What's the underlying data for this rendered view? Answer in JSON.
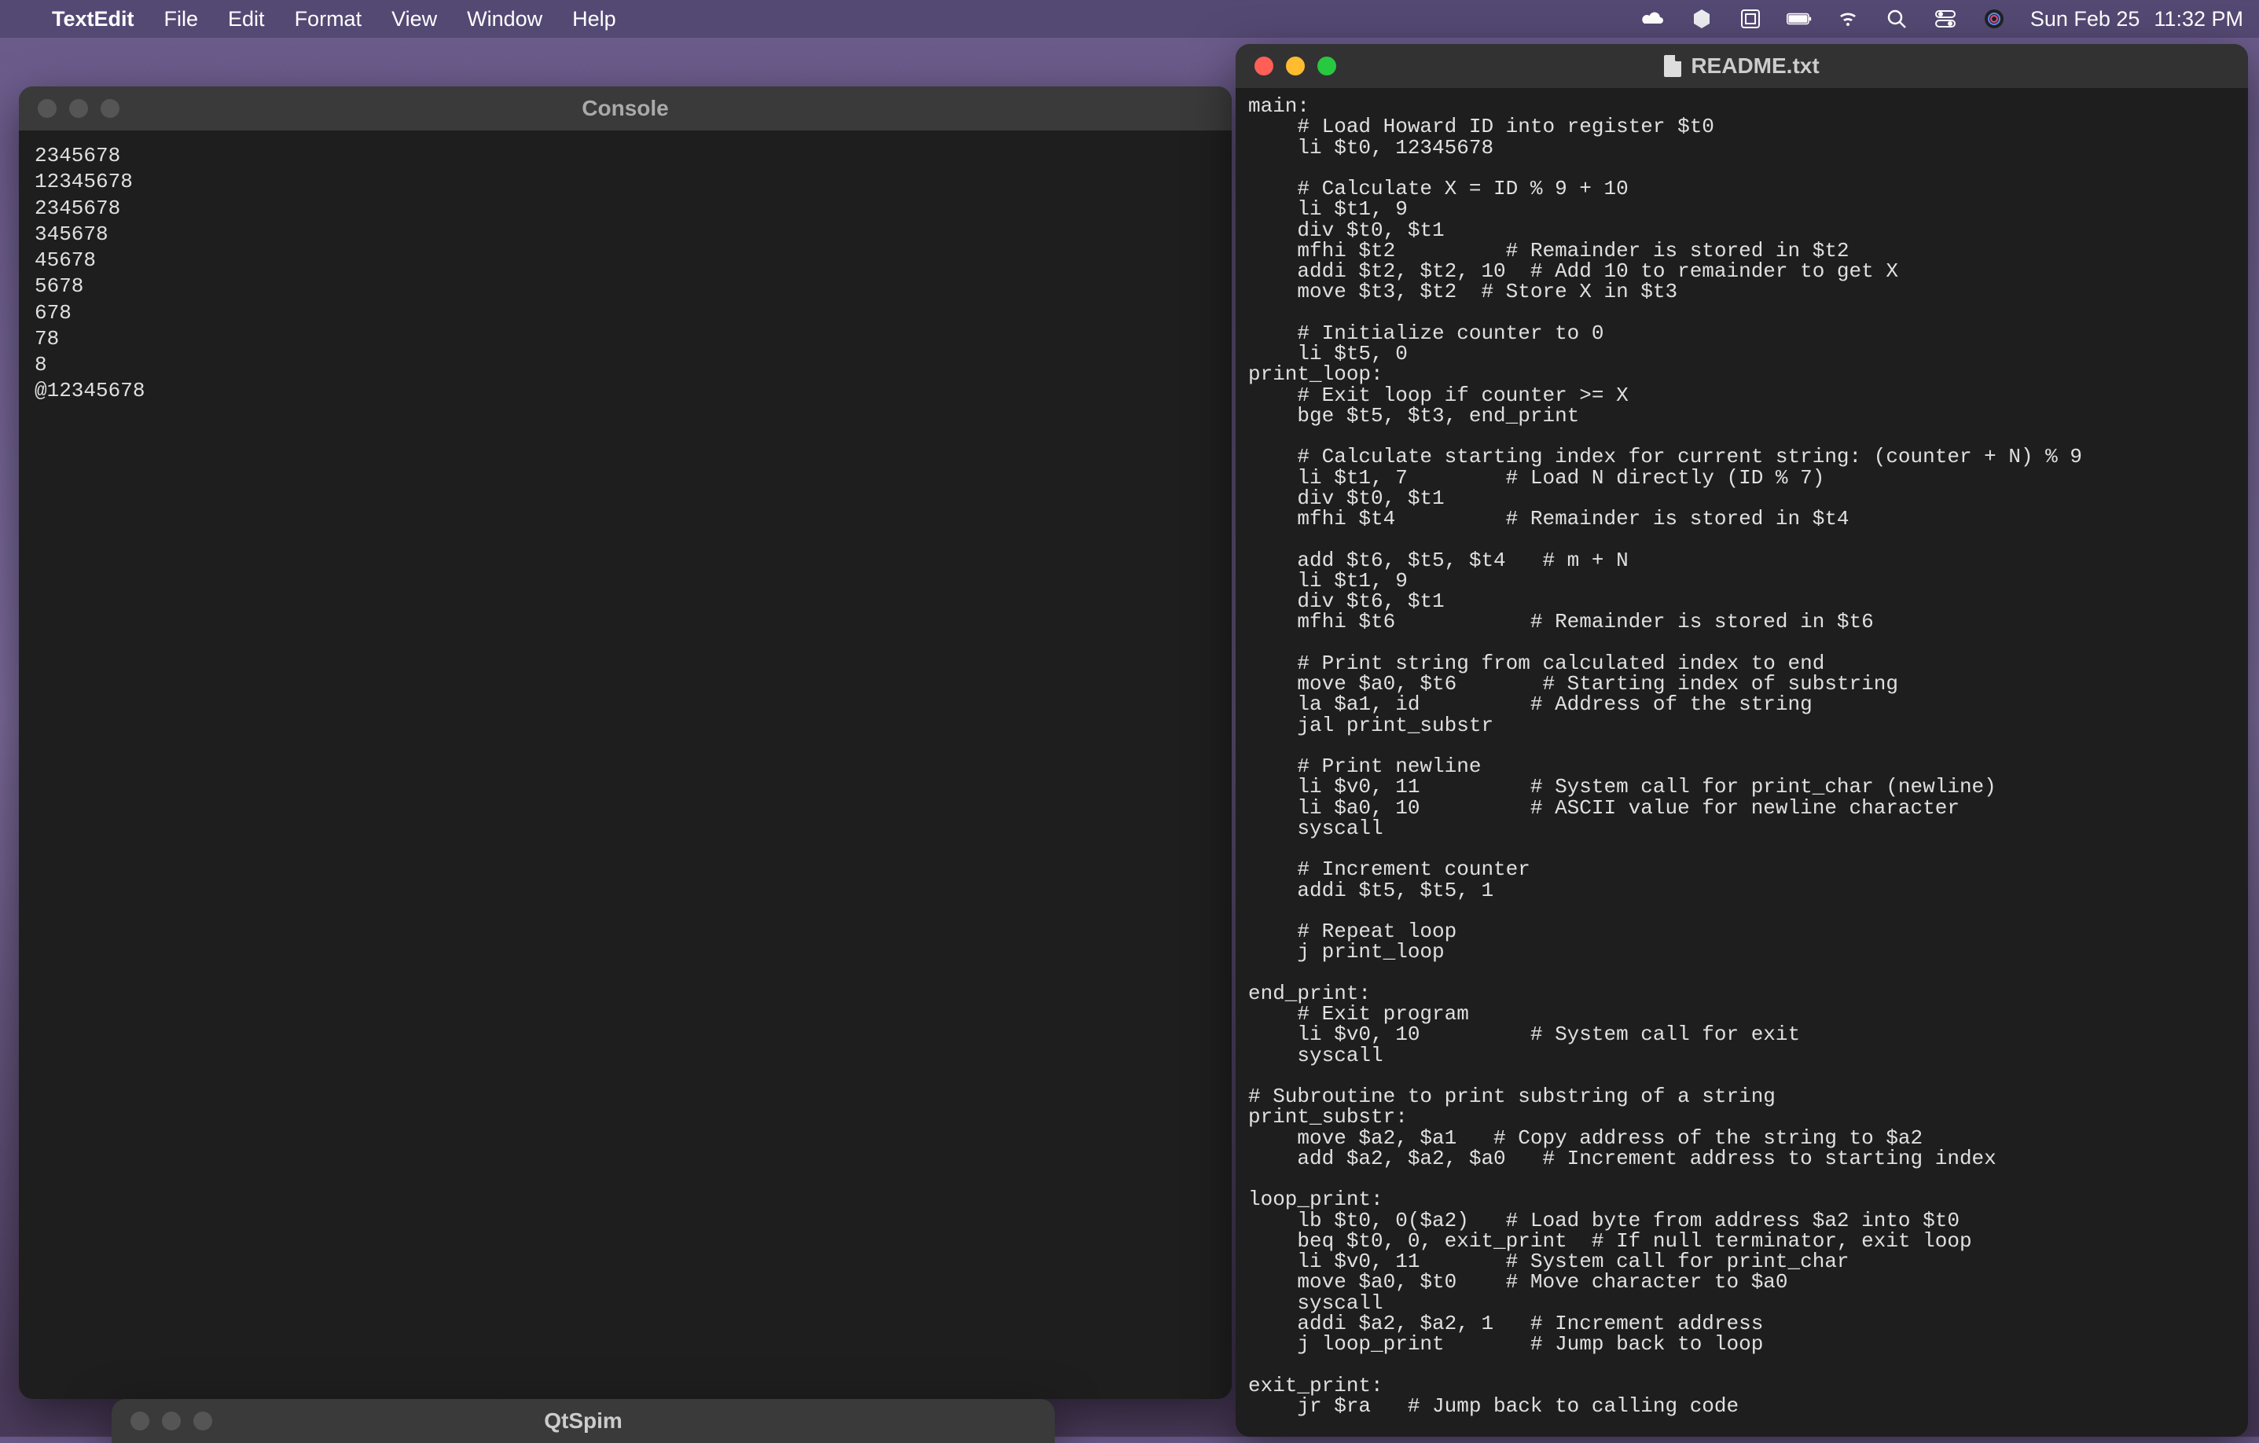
{
  "menubar": {
    "app_name": "TextEdit",
    "items": [
      "File",
      "Edit",
      "Format",
      "View",
      "Window",
      "Help"
    ],
    "date": "Sun Feb 25",
    "time": "11:32 PM"
  },
  "console_window": {
    "title": "Console",
    "content": "2345678\n12345678\n2345678\n345678\n45678\n5678\n678\n78\n8\n@12345678"
  },
  "textedit_window": {
    "title": "README.txt",
    "content": "main:\n    # Load Howard ID into register $t0\n    li $t0, 12345678\n\n    # Calculate X = ID % 9 + 10\n    li $t1, 9\n    div $t0, $t1\n    mfhi $t2         # Remainder is stored in $t2\n    addi $t2, $t2, 10  # Add 10 to remainder to get X\n    move $t3, $t2  # Store X in $t3\n\n    # Initialize counter to 0\n    li $t5, 0\nprint_loop:\n    # Exit loop if counter >= X\n    bge $t5, $t3, end_print\n\n    # Calculate starting index for current string: (counter + N) % 9\n    li $t1, 7        # Load N directly (ID % 7)\n    div $t0, $t1\n    mfhi $t4         # Remainder is stored in $t4\n\n    add $t6, $t5, $t4   # m + N\n    li $t1, 9\n    div $t6, $t1\n    mfhi $t6           # Remainder is stored in $t6\n\n    # Print string from calculated index to end\n    move $a0, $t6       # Starting index of substring\n    la $a1, id         # Address of the string\n    jal print_substr\n\n    # Print newline\n    li $v0, 11         # System call for print_char (newline)\n    li $a0, 10         # ASCII value for newline character\n    syscall\n\n    # Increment counter\n    addi $t5, $t5, 1\n\n    # Repeat loop\n    j print_loop\n\nend_print:\n    # Exit program\n    li $v0, 10         # System call for exit\n    syscall\n\n# Subroutine to print substring of a string\nprint_substr:\n    move $a2, $a1   # Copy address of the string to $a2\n    add $a2, $a2, $a0   # Increment address to starting index\n\nloop_print:\n    lb $t0, 0($a2)   # Load byte from address $a2 into $t0\n    beq $t0, 0, exit_print  # If null terminator, exit loop\n    li $v0, 11       # System call for print_char\n    move $a0, $t0    # Move character to $a0\n    syscall\n    addi $a2, $a2, 1   # Increment address\n    j loop_print       # Jump back to loop\n\nexit_print:\n    jr $ra   # Jump back to calling code"
  },
  "qtspim_window": {
    "title": "QtSpim"
  }
}
